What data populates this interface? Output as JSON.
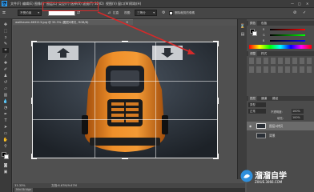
{
  "menubar": {
    "logo": "Ps",
    "items": [
      "文件(F)",
      "编辑(E)",
      "图像(I)",
      "图层(L)",
      "类型(Y)",
      "选择(S)",
      "滤镜(T)",
      "3D(D)",
      "视图(V)",
      "窗口(W)",
      "帮助(H)"
    ],
    "window_controls": [
      "—",
      "□",
      "✕"
    ]
  },
  "options": {
    "ratio_preset": "不受约束",
    "ratio_input": "",
    "straighten_label": "拉直",
    "view_label": "视图:",
    "view_value": "三等分",
    "delete_cropped_label": "删除裁剪的像素"
  },
  "document": {
    "tab_title": "wallhaven-663213.jpg @ 33.3% (图层0拷贝, RGB/8)",
    "close": "×"
  },
  "status": {
    "zoom": "33.33%",
    "doc_info": "文档:6.67M/9.67M"
  },
  "bottom_tab": "Mini Bridge",
  "panels": {
    "color_tabs": [
      "颜色",
      "色板"
    ],
    "slider_labels": [
      "R",
      "G",
      "B"
    ],
    "adjust_tabs": [
      "调整",
      "样式"
    ],
    "layers_tabs": [
      "图层",
      "通道",
      "路径"
    ],
    "layers_kind": "类型",
    "blend_mode": "正常",
    "opacity_label": "不透明度:",
    "opacity_value": "100%",
    "fill_label": "填充:",
    "fill_value": "100%",
    "layers": [
      {
        "name": "图层0拷贝",
        "selected": true
      },
      {
        "name": "背景",
        "selected": false
      }
    ]
  },
  "watermark": {
    "text": "溜溜自学",
    "url": "ZIXUE.3066.COM"
  },
  "colors": {
    "accent_red": "#d42a2a",
    "ps_blue": "#31a8ff",
    "car_orange": "#e8801f"
  }
}
